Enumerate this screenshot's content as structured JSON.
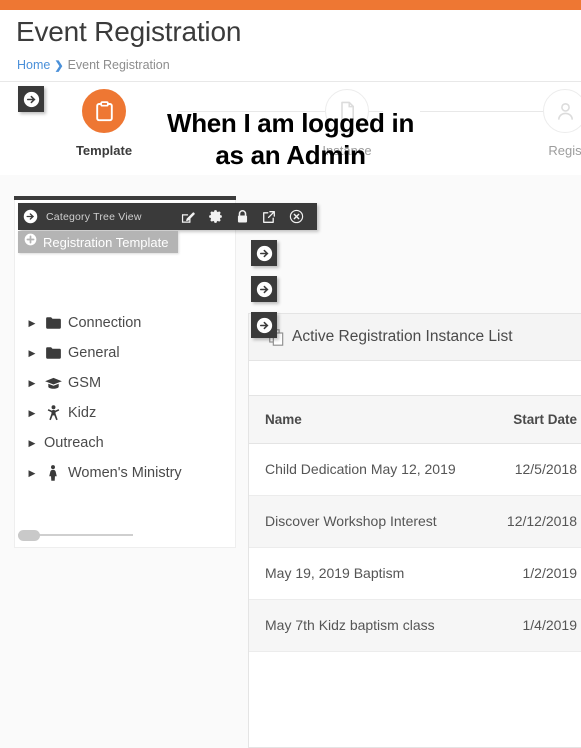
{
  "theme": {
    "accent": "#ee7733",
    "dark": "#3a3a3a",
    "link": "#4a90d9",
    "muted_grey": "#b4b4b4"
  },
  "header": {
    "title": "Event Registration",
    "breadcrumb": {
      "home": "Home",
      "separator": "❯",
      "current": "Event Registration"
    }
  },
  "stepper": {
    "steps": [
      {
        "label": "Template",
        "icon": "clipboard-icon",
        "active": true
      },
      {
        "label": "Instance",
        "icon": "file-icon",
        "active": false
      },
      {
        "label": "Regis",
        "icon": "person-icon",
        "active": false
      }
    ]
  },
  "overlay_annotation": {
    "line1": "When I am logged in",
    "line2": "as an Admin"
  },
  "tree_panel": {
    "toolbar": {
      "arrow_icon": "arrow-right-circle-icon",
      "title": "Category Tree View",
      "icons": [
        {
          "name": "edit-square-icon"
        },
        {
          "name": "gear-icon"
        },
        {
          "name": "lock-icon"
        },
        {
          "name": "external-link-icon"
        },
        {
          "name": "close-circle-icon"
        }
      ]
    },
    "add_button": {
      "icon": "plus-circle-icon",
      "label": "Registration Template"
    },
    "nodes": [
      {
        "label": "Connection",
        "icon": "folder-icon",
        "caret": "▶"
      },
      {
        "label": "General",
        "icon": "folder-icon",
        "caret": "▶"
      },
      {
        "label": "GSM",
        "icon": "graduation-cap-icon",
        "caret": "▶"
      },
      {
        "label": "Kidz",
        "icon": "child-icon",
        "caret": "▶"
      },
      {
        "label": "Outreach",
        "icon": "none",
        "caret": "▶"
      },
      {
        "label": "Women's Ministry",
        "icon": "female-icon",
        "caret": "▶"
      }
    ]
  },
  "floating_arrows": [
    {
      "name": "arrow-button-header",
      "icon": "arrow-right-circle-icon"
    },
    {
      "name": "arrow-button-a",
      "icon": "arrow-right-circle-icon"
    },
    {
      "name": "arrow-button-b",
      "icon": "arrow-right-circle-icon"
    },
    {
      "name": "arrow-button-c",
      "icon": "arrow-right-circle-icon"
    }
  ],
  "instance_panel": {
    "icon": "copy-icon",
    "title": "Active Registration Instance List",
    "columns": [
      "Name",
      "Start Date"
    ],
    "rows": [
      {
        "name": "Child Dedication May 12, 2019",
        "start_date": "12/5/2018"
      },
      {
        "name": "Discover Workshop Interest",
        "start_date": "12/12/2018"
      },
      {
        "name": "May 19, 2019 Baptism",
        "start_date": "1/2/2019"
      },
      {
        "name": "May 7th Kidz baptism class",
        "start_date": "1/4/2019"
      }
    ]
  }
}
